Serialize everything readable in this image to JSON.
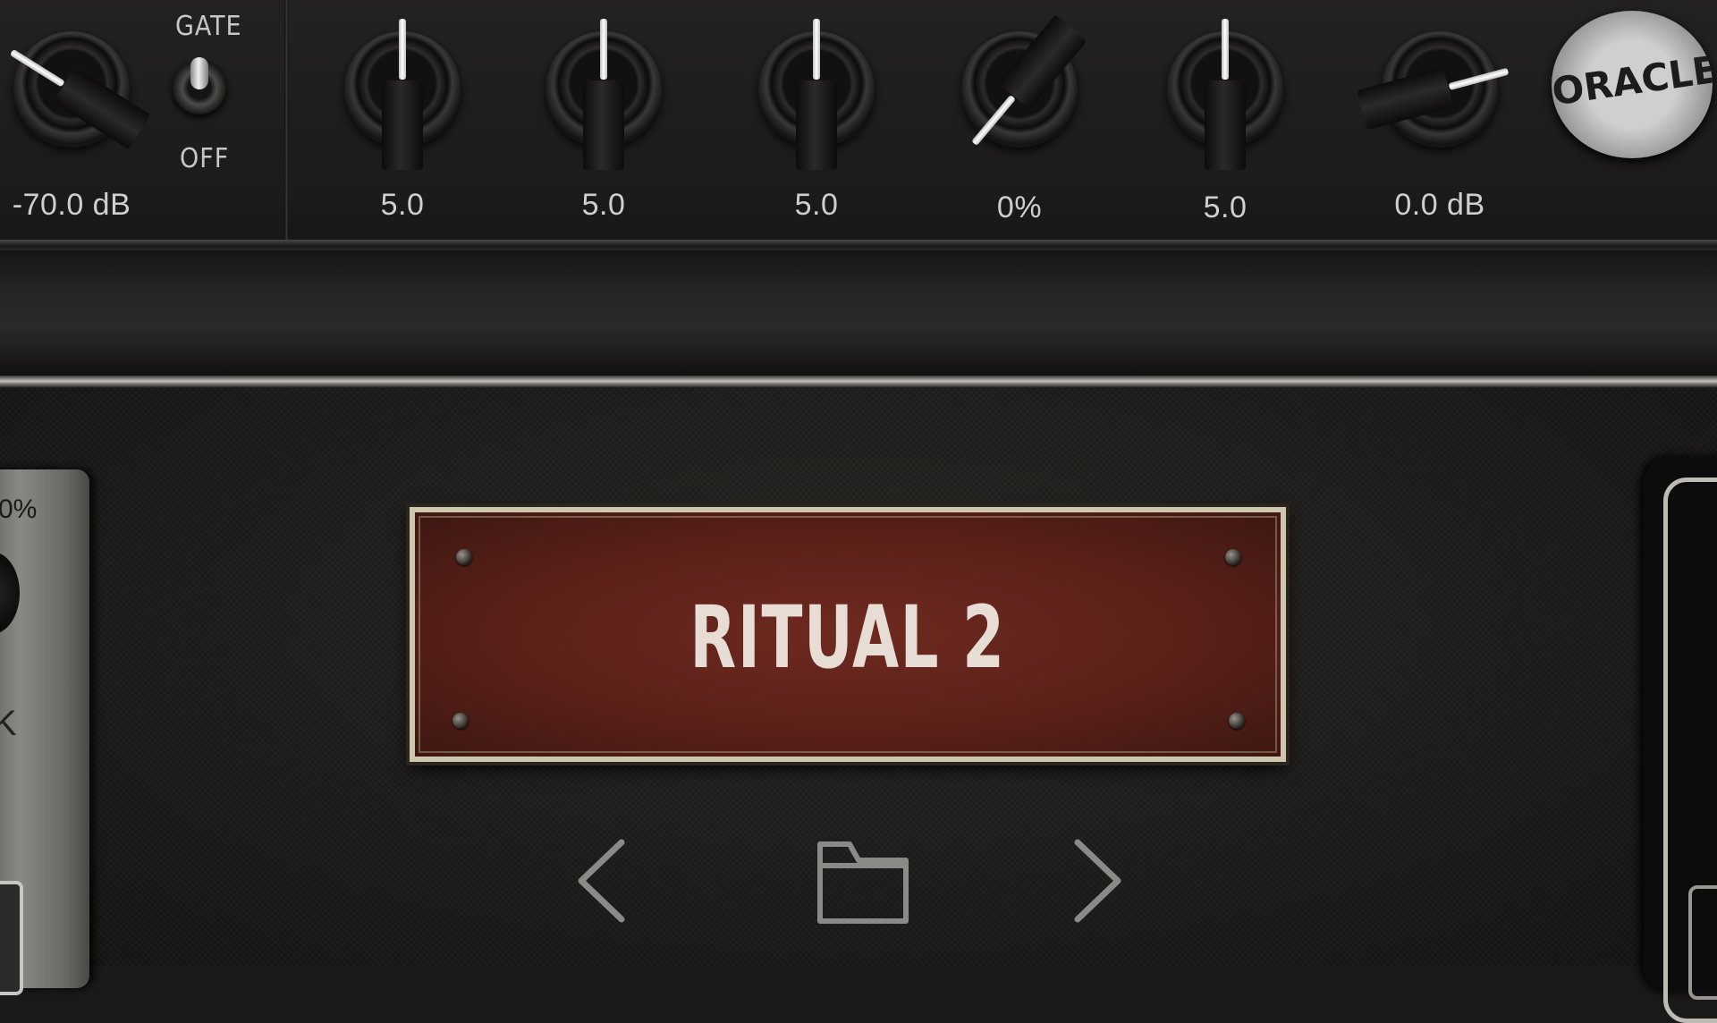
{
  "controls": {
    "gate_threshold": {
      "value": "-70.0 dB",
      "angle": -58
    },
    "gate_switch": {
      "label_top": "GATE",
      "label_bottom": "OFF"
    },
    "knobs": [
      {
        "value": "5.0",
        "angle": 0
      },
      {
        "value": "5.0",
        "angle": 0
      },
      {
        "value": "5.0",
        "angle": 0
      },
      {
        "value": "0%",
        "angle": -140
      },
      {
        "value": "5.0",
        "angle": 0
      },
      {
        "value": "0.0 dB",
        "angle": 75
      }
    ]
  },
  "brand": {
    "logo_text": "ORACLE"
  },
  "left_pedal": {
    "value_fragment": "0%",
    "label_fragment": "K"
  },
  "preset": {
    "name": "RITUAL 2"
  },
  "nav": {
    "prev_icon": "chevron-left-icon",
    "folder_icon": "folder-icon",
    "next_icon": "chevron-right-icon"
  },
  "colors": {
    "plate": "#5a2119",
    "plate_border": "#cfc7ad",
    "pointer": "#ffffff"
  }
}
